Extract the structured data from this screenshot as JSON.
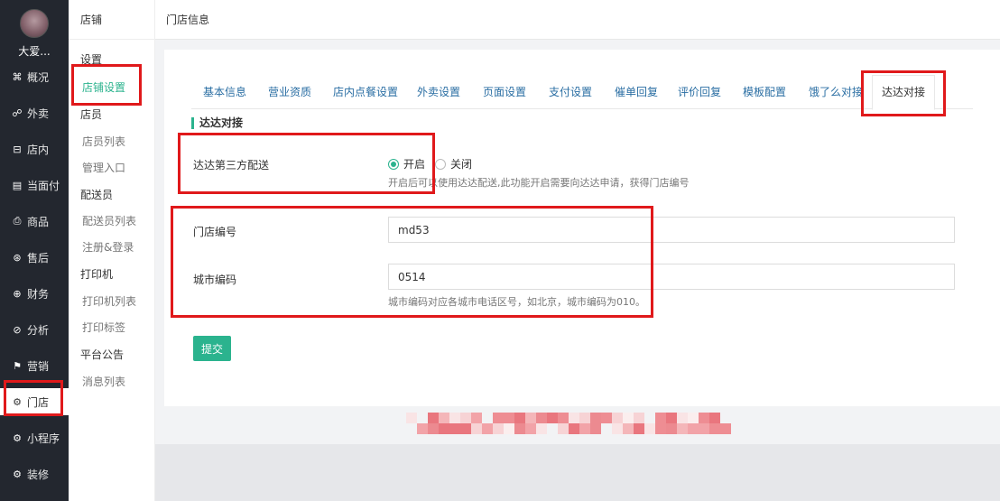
{
  "nav": {
    "shop_name": "大爱...",
    "items": [
      {
        "icon": "overview-icon",
        "glyph": "⌘",
        "label": "概况"
      },
      {
        "icon": "takeout-icon",
        "glyph": "☍",
        "label": "外卖"
      },
      {
        "icon": "dine-in-icon",
        "glyph": "⊟",
        "label": "店内"
      },
      {
        "icon": "face-pay-icon",
        "glyph": "▤",
        "label": "当面付"
      },
      {
        "icon": "goods-icon",
        "glyph": "⎙",
        "label": "商品"
      },
      {
        "icon": "after-sale-icon",
        "glyph": "⊛",
        "label": "售后"
      },
      {
        "icon": "finance-icon",
        "glyph": "⊕",
        "label": "财务"
      },
      {
        "icon": "analysis-icon",
        "glyph": "⊘",
        "label": "分析"
      },
      {
        "icon": "marketing-icon",
        "glyph": "⚑",
        "label": "营销"
      },
      {
        "icon": "store-icon",
        "glyph": "⚙",
        "label": "门店"
      },
      {
        "icon": "mini-program-icon",
        "glyph": "⚙",
        "label": "小程序"
      },
      {
        "icon": "decoration-icon",
        "glyph": "⚙",
        "label": "装修"
      }
    ]
  },
  "side": {
    "title": "店铺",
    "groups": {
      "settings": "设置",
      "store_settings": "店铺设置",
      "staff": "店员",
      "staff_list": "店员列表",
      "manage_entry": "管理入口",
      "courier": "配送员",
      "courier_list": "配送员列表",
      "register_login": "注册&登录",
      "printer": "打印机",
      "printer_list": "打印机列表",
      "print_label": "打印标签",
      "announcement": "平台公告",
      "message_list": "消息列表"
    }
  },
  "header": {
    "title": "门店信息"
  },
  "tabs": [
    "基本信息",
    "营业资质",
    "店内点餐设置",
    "外卖设置",
    "页面设置",
    "支付设置",
    "催单回复",
    "评价回复",
    "模板配置",
    "饿了么对接",
    "达达对接"
  ],
  "form": {
    "section_title": "达达对接",
    "third_party_label": "达达第三方配送",
    "opt_on": "开启",
    "opt_off": "关闭",
    "third_party_hint": "开启后可以使用达达配送,此功能开启需要向达达申请，获得门店编号",
    "store_no_label": "门店编号",
    "store_no_value": "md53",
    "city_code_label": "城市编码",
    "city_code_value": "0514",
    "city_code_hint": "城市编码对应各城市电话区号，如北京，城市编码为010。",
    "submit": "提交"
  },
  "colors": {
    "accent": "#2bb38e",
    "nav_bg": "#23272f",
    "tab_link": "#2a6ea3",
    "highlight": "#e0191b"
  }
}
